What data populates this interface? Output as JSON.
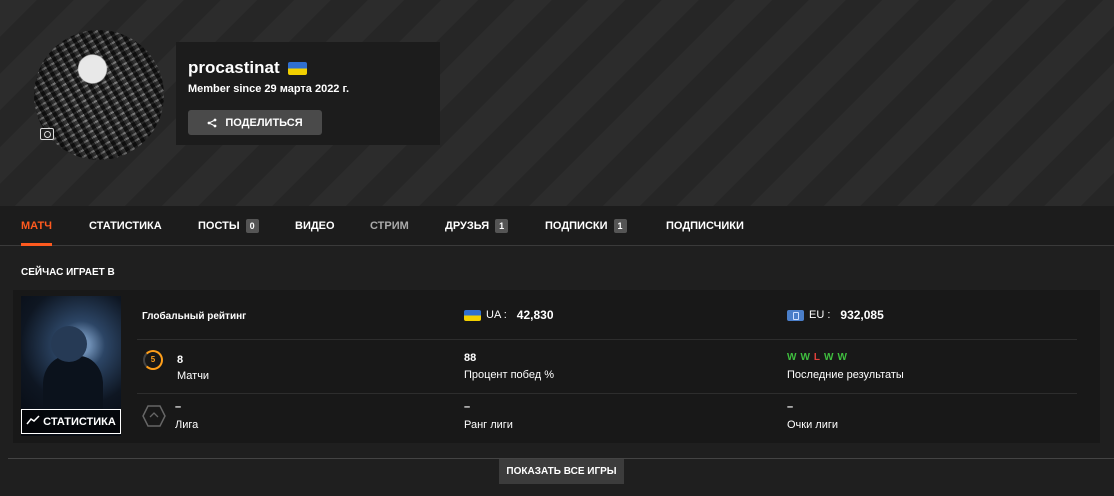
{
  "profile": {
    "username": "procastinat",
    "member_since": "Member since 29 марта 2022 г.",
    "share_label": "ПОДЕЛИТЬСЯ"
  },
  "tabs": [
    {
      "label": "МАТЧ",
      "active": true
    },
    {
      "label": "СТАТИСТИКА"
    },
    {
      "label": "ПОСТЫ",
      "count": "0"
    },
    {
      "label": "ВИДЕО"
    },
    {
      "label": "СТРИМ"
    },
    {
      "label": "ДРУЗЬЯ",
      "count": "1"
    },
    {
      "label": "ПОДПИСКИ",
      "count": "1"
    },
    {
      "label": "ПОДПИСЧИКИ"
    }
  ],
  "now_playing": {
    "title": "СЕЙЧАС ИГРАЕТ В",
    "stats_button": "СТАТИСТИКА",
    "global_rating_label": "Глобальный рейтинг",
    "ua": {
      "label": "UA :",
      "value": "42,830"
    },
    "eu": {
      "label": "EU :",
      "value": "932,085"
    },
    "level": "5",
    "matches": {
      "value": "8",
      "label": "Матчи"
    },
    "winrate": {
      "value": "88",
      "label": "Процент побед %"
    },
    "recent": {
      "label": "Последние результаты",
      "results": [
        "W",
        "W",
        "L",
        "W",
        "W"
      ]
    },
    "league": {
      "value": "–",
      "label": "Лига"
    },
    "league_rank": {
      "value": "–",
      "label": "Ранг лиги"
    },
    "league_points": {
      "value": "–",
      "label": "Очки лиги"
    }
  },
  "show_all_games": "ПОКАЗАТЬ ВСЕ ИГРЫ",
  "colors": {
    "accent": "#ff5a1f",
    "win": "#3fbf3f",
    "loss": "#e0403a"
  }
}
